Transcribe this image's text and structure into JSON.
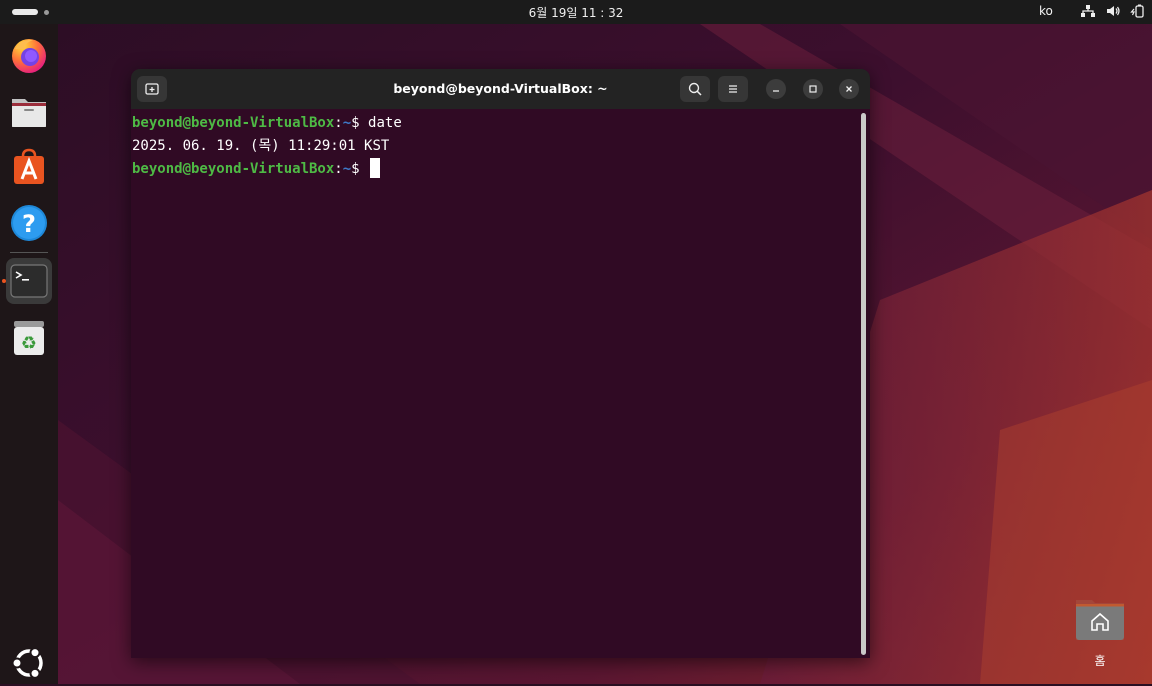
{
  "topbar": {
    "clock": "6월 19일  11 : 32",
    "language": "ko",
    "tray_icons": [
      "network-icon",
      "volume-icon",
      "battery-icon"
    ]
  },
  "dock": {
    "items": [
      {
        "name": "firefox",
        "icon": "firefox-icon"
      },
      {
        "name": "files",
        "icon": "folder-icon"
      },
      {
        "name": "app-center",
        "icon": "app-center-icon"
      },
      {
        "name": "help",
        "icon": "help-icon"
      },
      {
        "name": "terminal",
        "icon": "terminal-icon",
        "active": true
      },
      {
        "name": "trash",
        "icon": "trash-icon"
      }
    ],
    "show_apps_icon": "ubuntu-logo-icon"
  },
  "terminal": {
    "title": "beyond@beyond-VirtualBox: ~",
    "lines": [
      {
        "user": "beyond@beyond-VirtualBox",
        "path": "~",
        "command": "date"
      },
      {
        "output": "2025. 06. 19. (목) 11:29:01 KST"
      },
      {
        "user": "beyond@beyond-VirtualBox",
        "path": "~",
        "command": ""
      }
    ],
    "prompt_symbol": "$",
    "colors": {
      "background": "#300a24",
      "user": "#4eba45",
      "path": "#3e79c7",
      "text": "#ffffff"
    }
  },
  "desktop": {
    "home_label": "홈"
  }
}
